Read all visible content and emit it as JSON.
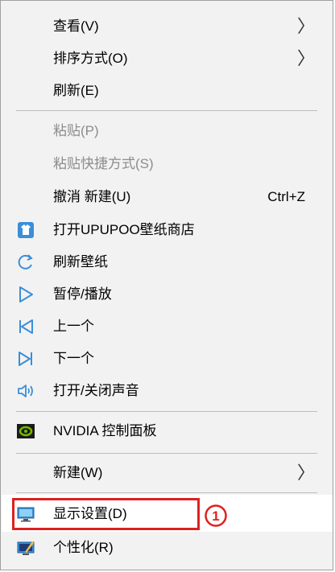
{
  "menu": {
    "items": [
      {
        "label": "查看(V)",
        "has_submenu": true
      },
      {
        "label": "排序方式(O)",
        "has_submenu": true
      },
      {
        "label": "刷新(E)"
      },
      {
        "label": "粘贴(P)",
        "disabled": true
      },
      {
        "label": "粘贴快捷方式(S)",
        "disabled": true
      },
      {
        "label": "撤消 新建(U)",
        "shortcut": "Ctrl+Z"
      },
      {
        "label": "打开UPUPOO壁纸商店",
        "icon": "upupoo-store-icon"
      },
      {
        "label": "刷新壁纸",
        "icon": "refresh-icon"
      },
      {
        "label": "暂停/播放",
        "icon": "play-icon"
      },
      {
        "label": "上一个",
        "icon": "previous-icon"
      },
      {
        "label": "下一个",
        "icon": "next-icon"
      },
      {
        "label": "打开/关闭声音",
        "icon": "speaker-icon"
      },
      {
        "label": "NVIDIA 控制面板",
        "icon": "nvidia-icon"
      },
      {
        "label": "新建(W)",
        "has_submenu": true
      },
      {
        "label": "显示设置(D)",
        "icon": "display-icon",
        "highlighted": true
      },
      {
        "label": "个性化(R)",
        "icon": "personalize-icon"
      }
    ],
    "submenu_arrow": "〉"
  },
  "annotation": {
    "callout_number": "1",
    "box_color": "#e02020"
  },
  "colors": {
    "menu_bg": "#f2f2f2",
    "disabled_text": "#8c8c8c",
    "icon_blue": "#3a8fd8",
    "nvidia_green": "#76b900"
  }
}
